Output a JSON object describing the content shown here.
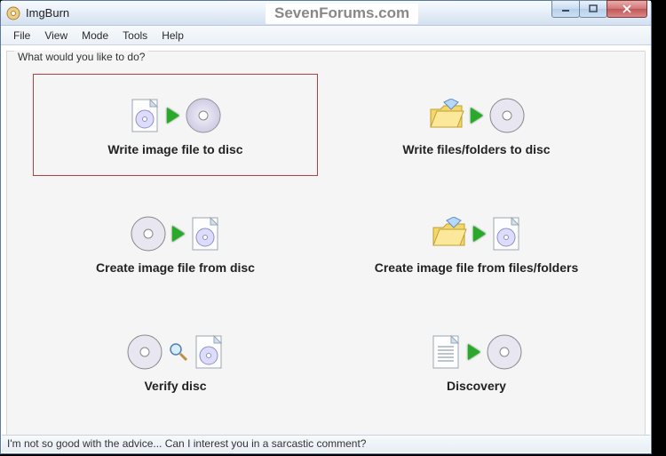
{
  "app": {
    "title": "ImgBurn",
    "watermark": "SevenForums.com"
  },
  "menu": {
    "file": "File",
    "view": "View",
    "mode": "Mode",
    "tools": "Tools",
    "help": "Help"
  },
  "panel": {
    "title": "What would you like to do?"
  },
  "actions": {
    "write_image": "Write image file to disc",
    "write_files": "Write files/folders to disc",
    "create_from_disc": "Create image file from disc",
    "create_from_files": "Create image file from files/folders",
    "verify": "Verify disc",
    "discovery": "Discovery"
  },
  "status": {
    "text": "I'm not so good with the advice... Can I interest you in a sarcastic comment?"
  }
}
